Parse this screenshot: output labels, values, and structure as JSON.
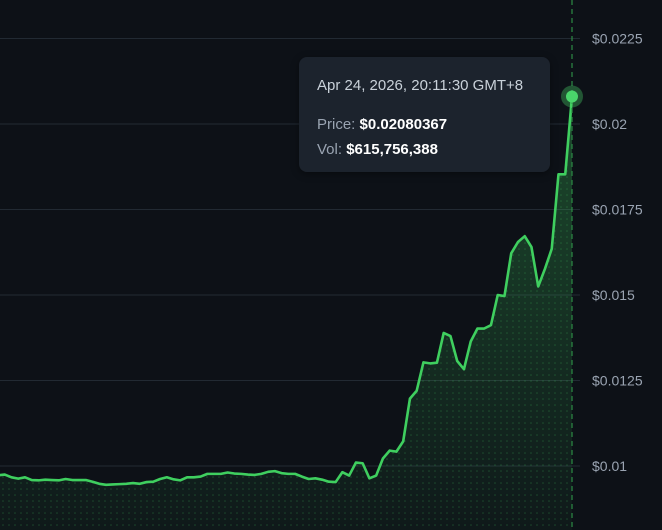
{
  "colors": {
    "background": "#0d1117",
    "line": "#3fcf5f",
    "grid": "#222a33",
    "marker": "#4ad66b",
    "crosshair": "#2c8a44",
    "tooltip_bg": "#1c232d"
  },
  "tooltip": {
    "datetime": "Apr 24, 2026, 20:11:30 GMT+8",
    "price_label": "Price:",
    "price_value": "$0.02080367",
    "vol_label": "Vol:",
    "vol_value": "$615,756,388"
  },
  "chart_data": {
    "type": "area",
    "title": "",
    "xlabel": "",
    "ylabel": "",
    "ylim": [
      0.0091,
      0.0235
    ],
    "grid": true,
    "y_axis_position": "right",
    "y_ticks": [
      {
        "value": 0.01,
        "label": "$0.01"
      },
      {
        "value": 0.0125,
        "label": "$0.0125"
      },
      {
        "value": 0.015,
        "label": "$0.015"
      },
      {
        "value": 0.0175,
        "label": "$0.0175"
      },
      {
        "value": 0.02,
        "label": "$0.02"
      },
      {
        "value": 0.0225,
        "label": "$0.0225"
      }
    ],
    "series": [
      {
        "values": [
          0.00973,
          0.00975,
          0.00967,
          0.00963,
          0.00967,
          0.00959,
          0.00958,
          0.0096,
          0.00959,
          0.00958,
          0.00962,
          0.00959,
          0.00959,
          0.00959,
          0.00954,
          0.00948,
          0.00945,
          0.00946,
          0.00947,
          0.00948,
          0.0095,
          0.00948,
          0.00953,
          0.00954,
          0.00962,
          0.00967,
          0.00961,
          0.00958,
          0.00967,
          0.00967,
          0.00969,
          0.00977,
          0.00977,
          0.00977,
          0.00981,
          0.00978,
          0.00977,
          0.00975,
          0.00974,
          0.00977,
          0.00983,
          0.00985,
          0.00979,
          0.00977,
          0.00977,
          0.00969,
          0.00962,
          0.00964,
          0.0096,
          0.00954,
          0.00953,
          0.00982,
          0.00972,
          0.0101,
          0.01008,
          0.00964,
          0.00972,
          0.01022,
          0.01045,
          0.01042,
          0.01072,
          0.01197,
          0.0122,
          0.01303,
          0.013,
          0.01302,
          0.01389,
          0.0138,
          0.01307,
          0.01283,
          0.01364,
          0.01402,
          0.01402,
          0.01412,
          0.015,
          0.01497,
          0.01622,
          0.01655,
          0.01672,
          0.0164,
          0.01525,
          0.01577,
          0.01635,
          0.01853,
          0.01853,
          0.02080367
        ]
      }
    ],
    "highlight": {
      "index": 85,
      "value": 0.02080367
    }
  }
}
